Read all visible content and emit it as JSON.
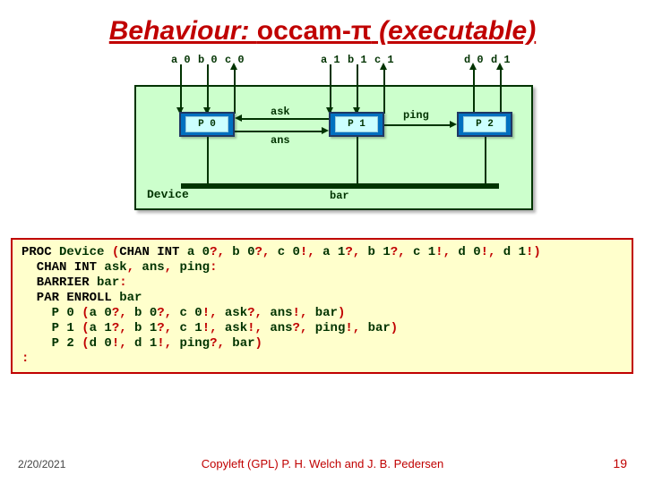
{
  "title": {
    "pre": "Behaviour: ",
    "mid": "occam-π",
    "post": " (executable)"
  },
  "io": {
    "a0": "a 0",
    "b0": "b 0",
    "c0": "c 0",
    "a1": "a 1",
    "b1": "b 1",
    "c1": "c 1",
    "d0": "d 0",
    "d1": "d 1"
  },
  "chan": {
    "ask": "ask",
    "ans": "ans",
    "ping": "ping",
    "bar": "bar"
  },
  "proc": {
    "p0": "P 0",
    "p1": "P 1",
    "p2": "P 2"
  },
  "device_label": "Device",
  "code": {
    "l1a": "PROC",
    "l1b": " Device ",
    "l1c": "(",
    "l1d": "CHAN INT",
    "l1e": " a 0",
    "l1f": "?,",
    "l1g": " b 0",
    "l1h": "?,",
    "l1i": " c 0",
    "l1j": "!,",
    "l1k": " a 1",
    "l1l": "?,",
    "l1m": " b 1",
    "l1n": "?,",
    "l1o": " c 1",
    "l1p": "!,",
    "l1q": " d 0",
    "l1r": "!,",
    "l1s": " d 1",
    "l1t": "!)",
    "l2a": "  CHAN INT",
    "l2b": " ask",
    "l2c": ",",
    "l2d": " ans",
    "l2e": ",",
    "l2f": " ping",
    "l2g": ":",
    "l3a": "  BARRIER",
    "l3b": " bar",
    "l3c": ":",
    "l4a": "  PAR ENROLL",
    "l4b": " bar",
    "l5a": "    P 0 ",
    "l5b": "(",
    "l5c": "a 0",
    "l5d": "?,",
    "l5e": " b 0",
    "l5f": "?,",
    "l5g": " c 0",
    "l5h": "!,",
    "l5i": " ask",
    "l5j": "?,",
    "l5k": " ans",
    "l5l": "!,",
    "l5m": " bar",
    "l5n": ")",
    "l6a": "    P 1 ",
    "l6b": "(",
    "l6c": "a 1",
    "l6d": "?,",
    "l6e": " b 1",
    "l6f": "?,",
    "l6g": " c 1",
    "l6h": "!,",
    "l6i": " ask",
    "l6j": "!,",
    "l6k": " ans",
    "l6l": "?,",
    "l6m": " ping",
    "l6n": "!,",
    "l6o": " bar",
    "l6p": ")",
    "l7a": "    P 2 ",
    "l7b": "(",
    "l7c": "d 0",
    "l7d": "!,",
    "l7e": " d 1",
    "l7f": "!,",
    "l7g": " ping",
    "l7h": "?,",
    "l7i": " bar",
    "l7j": ")",
    "l8": ":"
  },
  "footer": {
    "date": "2/20/2021",
    "copy": "Copyleft (GPL) P. H. Welch and J. B. Pedersen",
    "num": "19"
  }
}
